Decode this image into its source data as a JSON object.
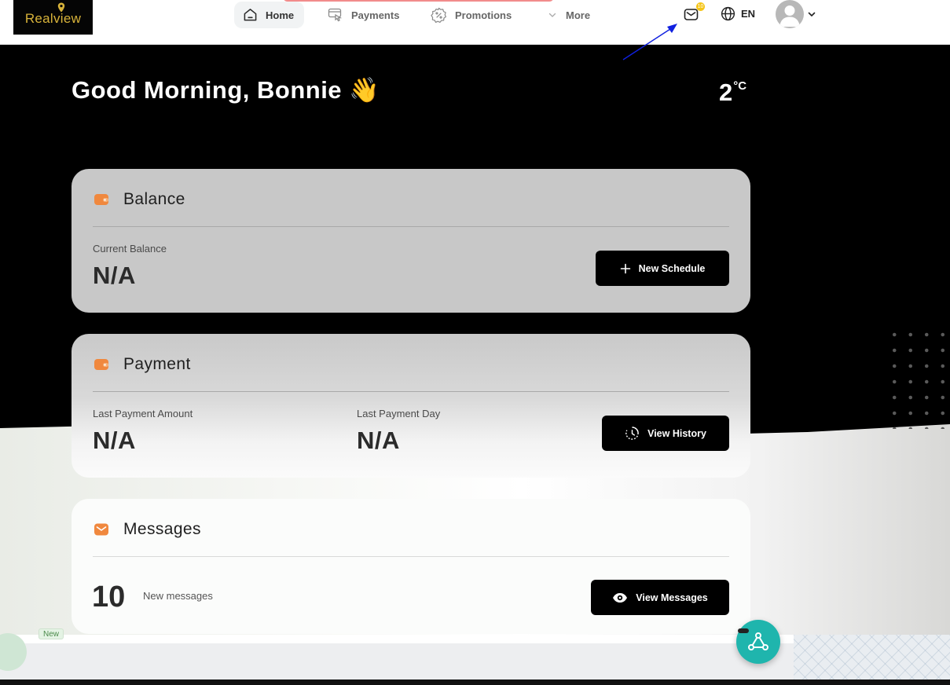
{
  "header": {
    "logo_text": "Realview",
    "nav": [
      {
        "label": "Home",
        "icon": "home-icon",
        "active": true
      },
      {
        "label": "Payments",
        "icon": "payment-card-icon",
        "active": false
      },
      {
        "label": "Promotions",
        "icon": "discount-badge-icon",
        "active": false
      },
      {
        "label": "More",
        "icon": "chevron-down-icon",
        "active": false
      }
    ],
    "mail_badge_count": "10",
    "language": "EN"
  },
  "greeting": {
    "text": "Good Morning, Bonnie 👋",
    "temperature_value": "2",
    "temperature_unit": "°C"
  },
  "balance_card": {
    "title": "Balance",
    "current_balance_label": "Current Balance",
    "current_balance_value": "N/A",
    "button_label": "New Schedule"
  },
  "payment_card": {
    "title": "Payment",
    "last_amount_label": "Last Payment Amount",
    "last_amount_value": "N/A",
    "last_day_label": "Last Payment Day",
    "last_day_value": "N/A",
    "button_label": "View History"
  },
  "messages_card": {
    "title": "Messages",
    "count": "10",
    "count_label": "New messages",
    "button_label": "View Messages"
  },
  "background_badge": "New",
  "colors": {
    "accent_orange": "#f0883e",
    "fab_teal": "#1fb5ad",
    "badge_yellow": "#f5c518",
    "logo_gold": "#d8b33a"
  }
}
